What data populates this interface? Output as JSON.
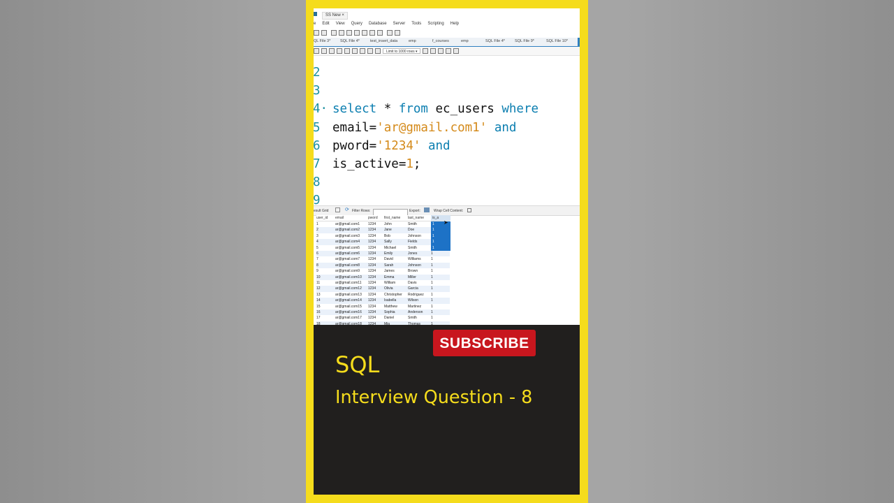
{
  "app": {
    "connection_tab": "SS New",
    "menu": [
      "e",
      "Edit",
      "View",
      "Query",
      "Database",
      "Server",
      "Tools",
      "Scripting",
      "Help"
    ]
  },
  "tabs": [
    "QL File 3*",
    "SQL File 4*",
    "test_insert_data",
    "emp",
    "f_courses",
    "emp",
    "SQL File 4*",
    "SQL File 9*",
    "SQL File 10*"
  ],
  "query_toolbar": {
    "limit_label": "Limit to 1000 rows"
  },
  "editor": {
    "lines": [
      {
        "num": "2",
        "parts": []
      },
      {
        "num": "3",
        "parts": []
      },
      {
        "num": "4·",
        "parts": [
          {
            "t": "select",
            "c": "kw"
          },
          {
            "t": " * ",
            "c": ""
          },
          {
            "t": "from",
            "c": "kw"
          },
          {
            "t": " ec_users ",
            "c": ""
          },
          {
            "t": "where",
            "c": "kw"
          }
        ]
      },
      {
        "num": "5",
        "parts": [
          {
            "t": "email=",
            "c": ""
          },
          {
            "t": "'ar@gmail.com1'",
            "c": "str"
          },
          {
            "t": " ",
            "c": ""
          },
          {
            "t": "and",
            "c": "kw"
          }
        ]
      },
      {
        "num": "6",
        "parts": [
          {
            "t": "pword=",
            "c": ""
          },
          {
            "t": "'1234'",
            "c": "str"
          },
          {
            "t": " ",
            "c": ""
          },
          {
            "t": "and",
            "c": "kw"
          }
        ]
      },
      {
        "num": "7",
        "parts": [
          {
            "t": "is_active=",
            "c": ""
          },
          {
            "t": "1",
            "c": "num"
          },
          {
            "t": ";",
            "c": ""
          }
        ]
      },
      {
        "num": "8",
        "parts": []
      },
      {
        "num": "9",
        "parts": []
      }
    ]
  },
  "result_toolbar": {
    "result_grid": "esult Grid",
    "filter_rows": "Filter Rows:",
    "export": "Export:",
    "wrap": "Wrap Cell Content:"
  },
  "grid": {
    "columns": [
      "user_id",
      "email",
      "pword",
      "first_name",
      "last_name",
      "is_a"
    ],
    "rows": [
      [
        "1",
        "ar@gmail.com1",
        "1234",
        "John",
        "Smith",
        "1"
      ],
      [
        "2",
        "ar@gmail.com2",
        "1234",
        "Jane",
        "Doe",
        "1"
      ],
      [
        "3",
        "ar@gmail.com3",
        "1234",
        "Bob",
        "Johnson",
        "1"
      ],
      [
        "4",
        "ar@gmail.com4",
        "1234",
        "Sally",
        "Fields",
        "1"
      ],
      [
        "5",
        "ar@gmail.com5",
        "1234",
        "Michael",
        "Smith",
        "1"
      ],
      [
        "6",
        "ar@gmail.com6",
        "1234",
        "Emily",
        "Jones",
        "1"
      ],
      [
        "7",
        "ar@gmail.com7",
        "1234",
        "David",
        "Williams",
        "1"
      ],
      [
        "8",
        "ar@gmail.com8",
        "1234",
        "Sarah",
        "Johnson",
        "1"
      ],
      [
        "9",
        "ar@gmail.com9",
        "1234",
        "James",
        "Brown",
        "1"
      ],
      [
        "10",
        "ar@gmail.com10",
        "1234",
        "Emma",
        "Miller",
        "1"
      ],
      [
        "11",
        "ar@gmail.com11",
        "1234",
        "William",
        "Davis",
        "1"
      ],
      [
        "12",
        "ar@gmail.com12",
        "1234",
        "Olivia",
        "Garcia",
        "1"
      ],
      [
        "13",
        "ar@gmail.com13",
        "1234",
        "Christopher",
        "Rodriguez",
        "1"
      ],
      [
        "14",
        "ar@gmail.com14",
        "1234",
        "Isabella",
        "Wilson",
        "1"
      ],
      [
        "15",
        "ar@gmail.com15",
        "1234",
        "Matthew",
        "Martinez",
        "1"
      ],
      [
        "16",
        "ar@gmail.com16",
        "1234",
        "Sophia",
        "Anderson",
        "1"
      ],
      [
        "17",
        "ar@gmail.com17",
        "1234",
        "Daniel",
        "Smith",
        "1"
      ],
      [
        "18",
        "ar@gmail.com18",
        "1234",
        "Mia",
        "Thomas",
        "1"
      ]
    ],
    "selected_rows": 5
  },
  "overlay": {
    "subscribe": "SUBSCRIBE",
    "title": "SQL",
    "subtitle": "Interview Question - 8"
  },
  "colors": {
    "frame": "#f5dc1c",
    "panel": "#211f1e",
    "subscribe_bg": "#c8161e",
    "keyword": "#0b7eb0",
    "string": "#d48a1a",
    "line_number": "#1a8fa0",
    "selection": "#1d72c6"
  }
}
